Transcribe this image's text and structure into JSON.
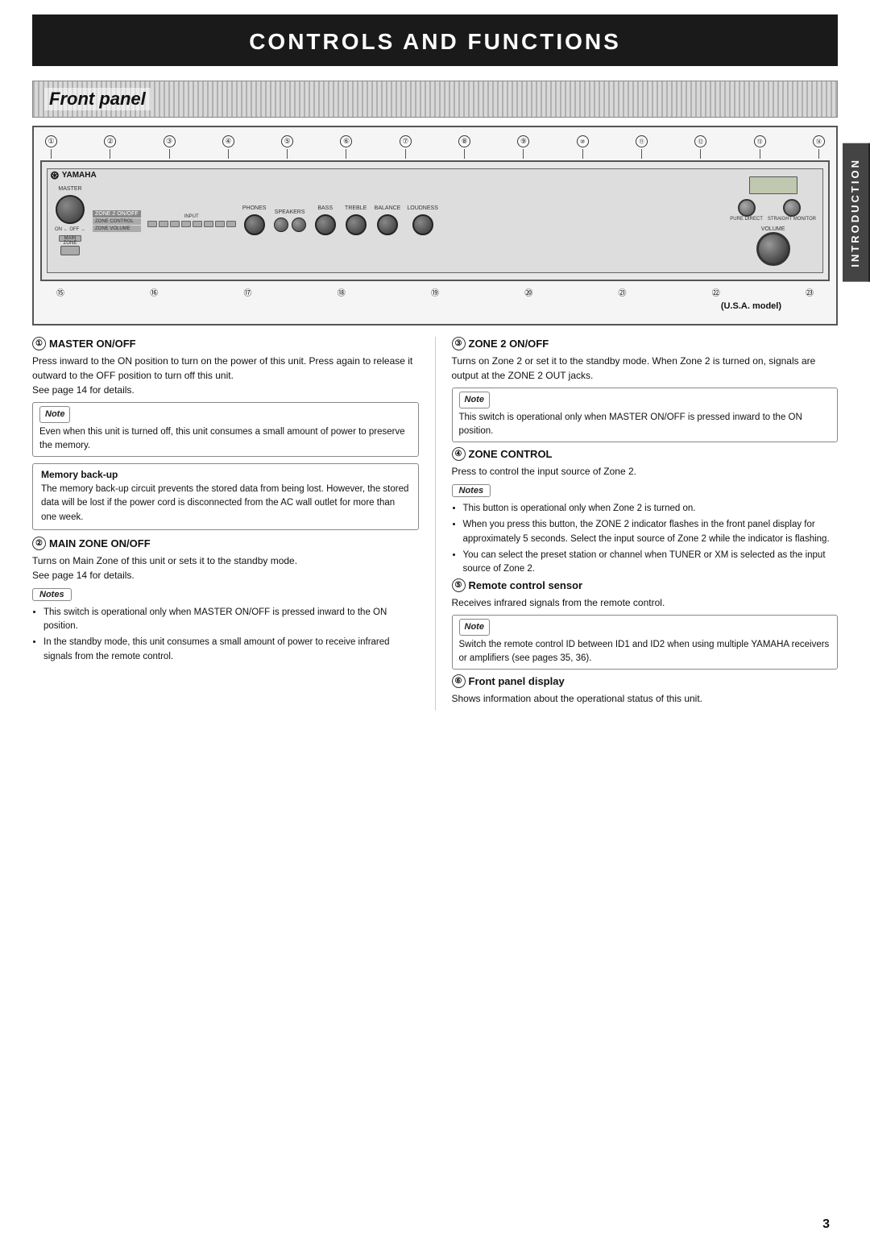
{
  "page": {
    "main_title": "CONTROLS AND FUNCTIONS",
    "front_panel_label": "Front panel",
    "side_tab_label": "INTRODUCTION",
    "page_number": "3",
    "usa_model_label": "(U.S.A. model)"
  },
  "top_numbers": [
    "①",
    "②",
    "③",
    "④",
    "⑤",
    "⑥",
    "⑦",
    "⑧",
    "⑨",
    "⑩",
    "⑪",
    "⑫",
    "⑬",
    "⑭"
  ],
  "bottom_numbers": [
    "⑮",
    "⑯",
    "⑰",
    "⑱",
    "⑲",
    "⑳",
    "㉑",
    "㉒",
    "㉓"
  ],
  "sections": {
    "left": [
      {
        "id": "s1",
        "num": "①",
        "heading": "MASTER ON/OFF",
        "body": "Press inward to the ON position to turn on the power of this unit. Press again to release it outward to the OFF position to turn off this unit.\nSee page 14 for details.",
        "has_note": true,
        "note_text": "Even when this unit is turned off, this unit consumes a small amount of power to preserve the memory."
      },
      {
        "id": "memory",
        "heading": "Memory back-up",
        "body": "The memory back-up circuit prevents the stored data from being lost. However, the stored data will be lost if the power cord is disconnected from the AC wall outlet for more than one week."
      },
      {
        "id": "s2",
        "num": "②",
        "heading": "MAIN ZONE ON/OFF",
        "body": "Turns on Main Zone of this unit or sets it to the standby mode.\nSee page 14 for details.",
        "has_notes": true,
        "notes": [
          "This switch is operational only when MASTER ON/OFF is pressed inward to the ON position.",
          "In the standby mode, this unit consumes a small amount of power to receive infrared signals from the remote control."
        ]
      }
    ],
    "right": [
      {
        "id": "s3",
        "num": "③",
        "heading": "ZONE 2 ON/OFF",
        "body": "Turns on Zone 2 or set it to the standby mode. When Zone 2 is turned on, signals are output at the ZONE 2 OUT jacks.",
        "has_note_label": true,
        "note_text": "This switch is operational only when MASTER ON/OFF is pressed inward to the ON position."
      },
      {
        "id": "s4",
        "num": "④",
        "heading": "ZONE CONTROL",
        "body": "Press to control the input source of Zone 2.",
        "has_notes": true,
        "notes": [
          "This button is operational only when Zone 2 is turned on.",
          "When you press this button, the ZONE 2 indicator flashes in the front panel display for approximately 5 seconds. Select the input source of Zone 2 while the indicator is flashing.",
          "You can select the preset station or channel when TUNER or XM is selected as the input source of Zone 2."
        ]
      },
      {
        "id": "s5",
        "num": "⑤",
        "heading": "Remote control sensor",
        "body": "Receives infrared signals from the remote control.",
        "has_note_label": true,
        "note_text": "Switch the remote control ID between ID1 and ID2 when using multiple YAMAHA receivers or amplifiers (see pages 35, 36)."
      },
      {
        "id": "s6",
        "num": "⑥",
        "heading": "Front panel display",
        "body": "Shows information about the operational status of this unit."
      }
    ]
  }
}
